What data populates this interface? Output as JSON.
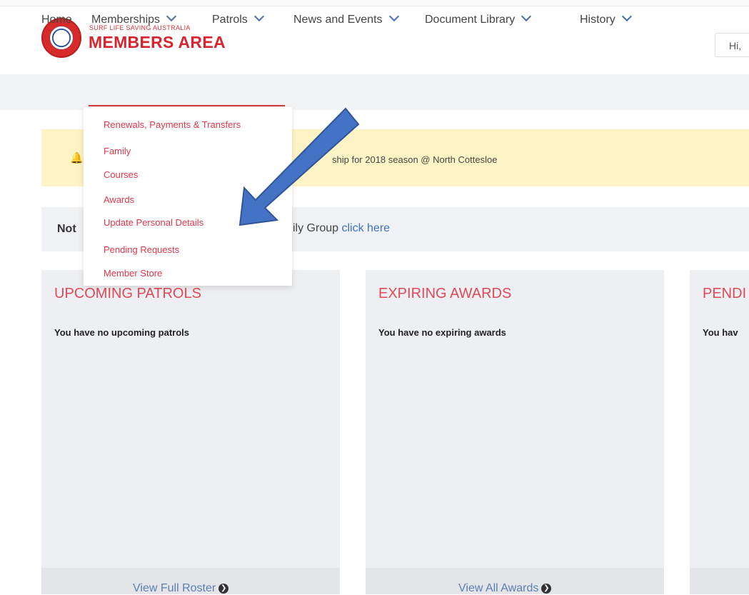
{
  "header": {
    "logo_small": "SURF LIFE SAVING AUSTRALIA",
    "logo_big": "MEMBERS AREA",
    "greeting": "Hi,"
  },
  "nav": {
    "items": [
      {
        "label": "Home"
      },
      {
        "label": "Memberships"
      },
      {
        "label": "Patrols"
      },
      {
        "label": "News and Events"
      },
      {
        "label": "Document Library"
      },
      {
        "label": "History"
      }
    ]
  },
  "memberships_menu": {
    "items": [
      {
        "label": "Renewals, Payments & Transfers"
      },
      {
        "label": "Family"
      },
      {
        "label": "Courses"
      },
      {
        "label": "Awards"
      },
      {
        "label": "Update Personal Details"
      },
      {
        "label": "Pending Requests"
      },
      {
        "label": "Member Store"
      }
    ]
  },
  "alert": {
    "text": "ship for 2018 season @ North Cottesloe"
  },
  "notice": {
    "prefix": "Not",
    "middle": "ily Group ",
    "link": "click here"
  },
  "cards": [
    {
      "title": "UPCOMING PATROLS",
      "text": "You have no upcoming patrols",
      "footer": "View Full Roster"
    },
    {
      "title": "EXPIRING AWARDS",
      "text": "You have no expiring awards",
      "footer": "View All Awards"
    },
    {
      "title": "PENDI",
      "text": "You hav",
      "footer": ""
    }
  ],
  "colors": {
    "brand_red": "#d7252f",
    "link_blue": "#3b73bf",
    "arrow_blue": "#4472c4",
    "alert_bg": "#fdf4c6"
  }
}
